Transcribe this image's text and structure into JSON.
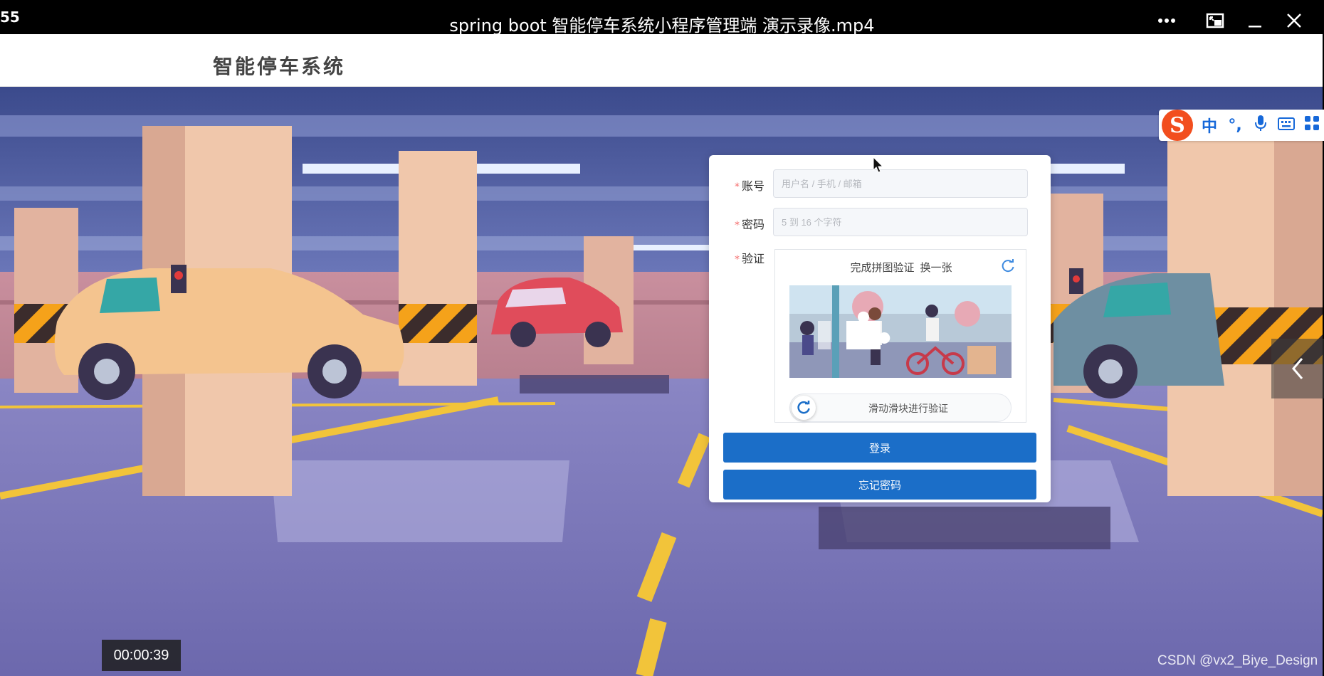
{
  "player": {
    "counter": "55",
    "title": "spring boot 智能停车系统小程序管理端 演示录像.mp4",
    "timecode": "00:00:39",
    "buttons": [
      "more-icon",
      "picture-in-picture-icon",
      "minimize-icon",
      "close-icon"
    ]
  },
  "page": {
    "site_title": "智能停车系统"
  },
  "ime": {
    "logo": "S",
    "items": [
      "中",
      "°,"
    ]
  },
  "login": {
    "account_label": "账号",
    "account_placeholder": "用户名 / 手机 / 邮箱",
    "password_label": "密码",
    "password_placeholder": "5 到 16 个字符",
    "verify_label": "验证",
    "captcha_title": "完成拼图验证",
    "captcha_swap": "换一张",
    "slider_text": "滑动滑块进行验证",
    "login_button": "登录",
    "forgot_button": "忘记密码"
  },
  "watermark": "CSDN @vx2_Biye_Design",
  "colors": {
    "primary": "#1b6ec8",
    "required": "#f56c6c",
    "ime_brand": "#f24e1e",
    "ime_icons": "#1668d9"
  }
}
